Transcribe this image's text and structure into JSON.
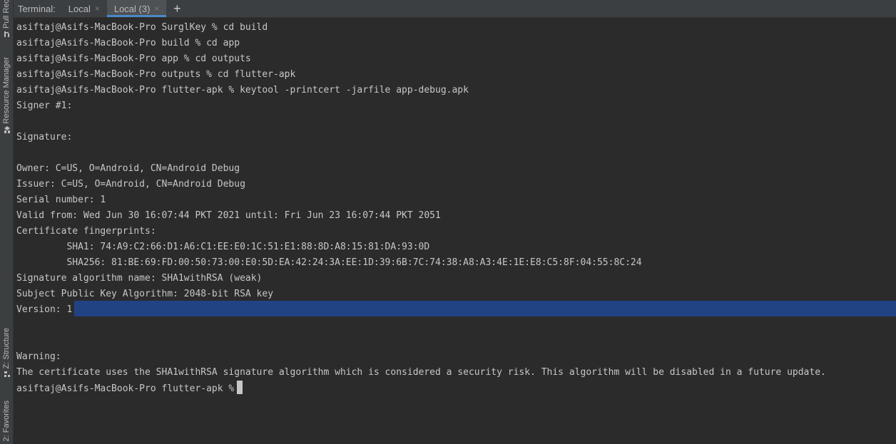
{
  "sidebar": {
    "pull_requests": "Pull Requests",
    "resource_manager": "Resource Manager",
    "structure": "Z: Structure",
    "favorites": "2: Favorites"
  },
  "tabbar": {
    "title": "Terminal:",
    "tabs": [
      {
        "label": "Local",
        "close": "×",
        "active": false
      },
      {
        "label": "Local (3)",
        "close": "×",
        "active": true
      }
    ],
    "add": "+"
  },
  "terminal": {
    "lines": [
      "asiftaj@Asifs-MacBook-Pro SurglKey % cd build",
      "asiftaj@Asifs-MacBook-Pro build % cd app",
      "asiftaj@Asifs-MacBook-Pro app % cd outputs",
      "asiftaj@Asifs-MacBook-Pro outputs % cd flutter-apk",
      "asiftaj@Asifs-MacBook-Pro flutter-apk % keytool -printcert -jarfile app-debug.apk",
      "Signer #1:",
      "",
      "Signature:",
      "",
      "Owner: C=US, O=Android, CN=Android Debug",
      "Issuer: C=US, O=Android, CN=Android Debug",
      "Serial number: 1",
      "Valid from: Wed Jun 30 16:07:44 PKT 2021 until: Fri Jun 23 16:07:44 PKT 2051",
      "Certificate fingerprints:",
      "         SHA1: 74:A9:C2:66:D1:A6:C1:EE:E0:1C:51:E1:88:8D:A8:15:81:DA:93:0D",
      "         SHA256: 81:BE:69:FD:00:50:73:00:E0:5D:EA:42:24:3A:EE:1D:39:6B:7C:74:38:A8:A3:4E:1E:E8:C5:8F:04:55:8C:24",
      "Signature algorithm name: SHA1withRSA (weak)",
      "Subject Public Key Algorithm: 2048-bit RSA key",
      "Version: 1",
      "",
      "",
      "Warning:",
      "The certificate uses the SHA1withRSA signature algorithm which is considered a security risk. This algorithm will be disabled in a future update.",
      "asiftaj@Asifs-MacBook-Pro flutter-apk %"
    ]
  }
}
